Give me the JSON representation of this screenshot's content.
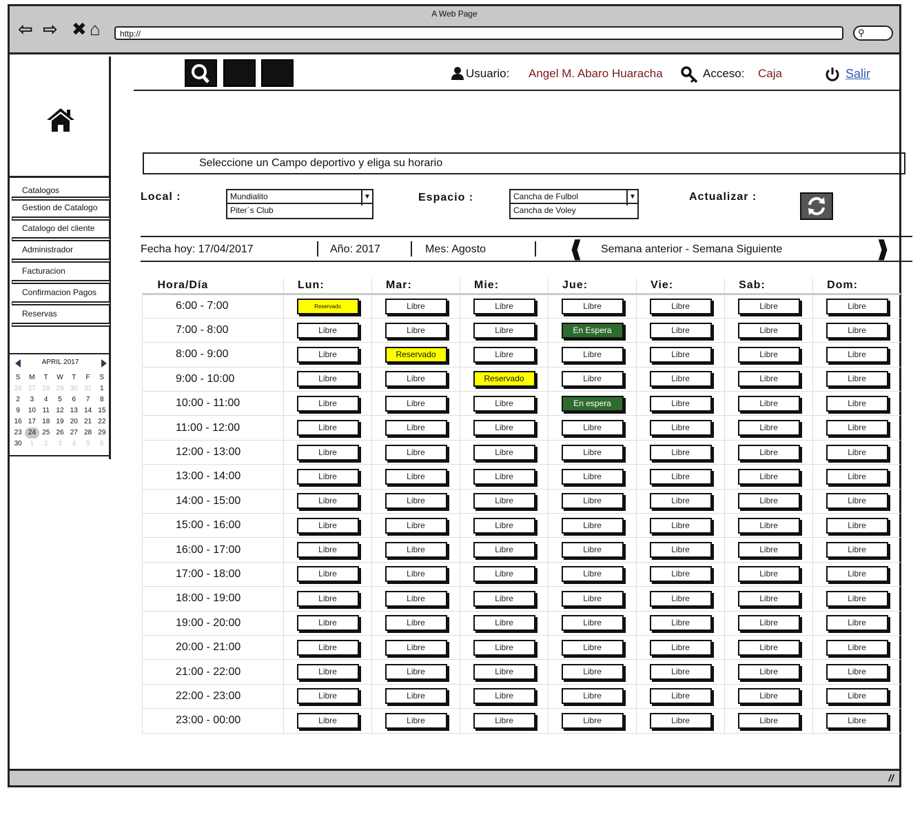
{
  "window": {
    "title": "A Web Page",
    "url": "http://"
  },
  "header": {
    "usuario_label": "Usuario:",
    "usuario_value": "Angel M. Abaro Huaracha",
    "acceso_label": "Acceso:",
    "acceso_value": "Caja",
    "salir_label": "Salir"
  },
  "sidebar": {
    "items": [
      {
        "label": "Catalogos"
      },
      {
        "label": "Gestion de Catalogo"
      },
      {
        "label": "Catalogo del cliente"
      },
      {
        "label": "Administrador"
      },
      {
        "label": "Facturacion"
      },
      {
        "label": "Confirmacion Pagos"
      },
      {
        "label": "Reservas"
      }
    ],
    "calendar": {
      "month": "APRIL 2017",
      "weekdays": [
        "S",
        "M",
        "T",
        "W",
        "T",
        "F",
        "S"
      ],
      "weeks": [
        [
          "26",
          "27",
          "28",
          "29",
          "30",
          "31",
          "1"
        ],
        [
          "2",
          "3",
          "4",
          "5",
          "6",
          "7",
          "8"
        ],
        [
          "9",
          "10",
          "11",
          "12",
          "13",
          "14",
          "15"
        ],
        [
          "16",
          "17",
          "18",
          "19",
          "20",
          "21",
          "22"
        ],
        [
          "23",
          "24",
          "25",
          "26",
          "27",
          "28",
          "29"
        ],
        [
          "30",
          "1",
          "2",
          "3",
          "4",
          "5",
          "6"
        ]
      ],
      "selected": "24"
    }
  },
  "instruction": "Seleccione un Campo deportivo y eliga su horario",
  "filters": {
    "local_label": "Local :",
    "local_options": [
      "Mundialito",
      "Piter´s Club"
    ],
    "espacio_label": "Espacio :",
    "espacio_options": [
      "Cancha de Fulbol",
      "Cancha de Voley"
    ],
    "actualizar_label": "Actualizar :"
  },
  "datebar": {
    "fecha": "Fecha hoy: 17/04/2017",
    "anio": "Año: 2017",
    "mes": "Mes: Agosto",
    "semana": "Semana anterior - Semana Siguiente"
  },
  "schedule": {
    "headers": [
      "Hora/Día",
      "Lun:",
      "Mar:",
      "Mie:",
      "Jue:",
      "Vie:",
      "Sab:",
      "Dom:"
    ],
    "rows": [
      {
        "hour": "6:00 - 7:00",
        "slots": [
          "Reservado",
          "Libre",
          "Libre",
          "Libre",
          "Libre",
          "Libre",
          "Libre"
        ]
      },
      {
        "hour": "7:00 - 8:00",
        "slots": [
          "Libre",
          "Libre",
          "Libre",
          "En Espera",
          "Libre",
          "Libre",
          "Libre"
        ]
      },
      {
        "hour": "8:00 - 9:00",
        "slots": [
          "Libre",
          "Reservado",
          "Libre",
          "Libre",
          "Libre",
          "Libre",
          "Libre"
        ]
      },
      {
        "hour": "9:00 - 10:00",
        "slots": [
          "Libre",
          "Libre",
          "Reservado",
          "Libre",
          "Libre",
          "Libre",
          "Libre"
        ]
      },
      {
        "hour": "10:00 - 11:00",
        "slots": [
          "Libre",
          "Libre",
          "Libre",
          "En espera",
          "Libre",
          "Libre",
          "Libre"
        ]
      },
      {
        "hour": "11:00 - 12:00",
        "slots": [
          "Libre",
          "Libre",
          "Libre",
          "Libre",
          "Libre",
          "Libre",
          "Libre"
        ]
      },
      {
        "hour": "12:00 - 13:00",
        "slots": [
          "Libre",
          "Libre",
          "Libre",
          "Libre",
          "Libre",
          "Libre",
          "Libre"
        ]
      },
      {
        "hour": "13:00 - 14:00",
        "slots": [
          "Libre",
          "Libre",
          "Libre",
          "Libre",
          "Libre",
          "Libre",
          "Libre"
        ]
      },
      {
        "hour": "14:00 - 15:00",
        "slots": [
          "Libre",
          "Libre",
          "Libre",
          "Libre",
          "Libre",
          "Libre",
          "Libre"
        ]
      },
      {
        "hour": "15:00 - 16:00",
        "slots": [
          "Libre",
          "Libre",
          "Libre",
          "Libre",
          "Libre",
          "Libre",
          "Libre"
        ]
      },
      {
        "hour": "16:00 - 17:00",
        "slots": [
          "Libre",
          "Libre",
          "Libre",
          "Libre",
          "Libre",
          "Libre",
          "Libre"
        ]
      },
      {
        "hour": "17:00 - 18:00",
        "slots": [
          "Libre",
          "Libre",
          "Libre",
          "Libre",
          "Libre",
          "Libre",
          "Libre"
        ]
      },
      {
        "hour": "18:00 - 19:00",
        "slots": [
          "Libre",
          "Libre",
          "Libre",
          "Libre",
          "Libre",
          "Libre",
          "Libre"
        ]
      },
      {
        "hour": "19:00 - 20:00",
        "slots": [
          "Libre",
          "Libre",
          "Libre",
          "Libre",
          "Libre",
          "Libre",
          "Libre"
        ]
      },
      {
        "hour": "20:00 - 21:00",
        "slots": [
          "Libre",
          "Libre",
          "Libre",
          "Libre",
          "Libre",
          "Libre",
          "Libre"
        ]
      },
      {
        "hour": "21:00 - 22:00",
        "slots": [
          "Libre",
          "Libre",
          "Libre",
          "Libre",
          "Libre",
          "Libre",
          "Libre"
        ]
      },
      {
        "hour": "22:00 - 23:00",
        "slots": [
          "Libre",
          "Libre",
          "Libre",
          "Libre",
          "Libre",
          "Libre",
          "Libre"
        ]
      },
      {
        "hour": "23:00 - 00:00",
        "slots": [
          "Libre",
          "Libre",
          "Libre",
          "Libre",
          "Libre",
          "Libre",
          "Libre"
        ]
      }
    ]
  },
  "colors": {
    "reservado": "#ffff00",
    "espera": "#2e6b2e",
    "libre": "#ffffff",
    "user_value": "#7a1a1a",
    "link": "#2a5cb8"
  },
  "icons": [
    "back-icon",
    "forward-icon",
    "close-icon",
    "home-icon",
    "search-icon",
    "user-icon",
    "key-icon",
    "power-icon",
    "refresh-icon",
    "chevron-left-icon",
    "chevron-right-icon"
  ]
}
